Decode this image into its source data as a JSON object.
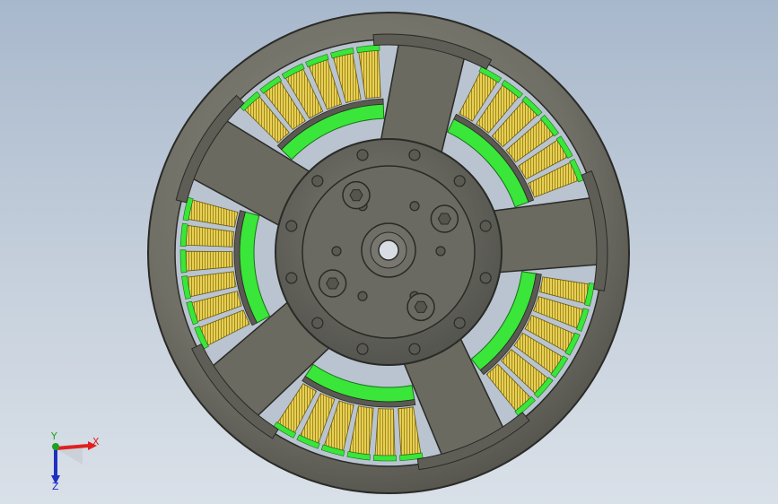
{
  "viewport": {
    "background_top": "#a8b8cc",
    "background_bottom": "#d9e0e8"
  },
  "model": {
    "name_icon": "motor-model-icon",
    "colors": {
      "housing": "#6f6f66",
      "housing_dark": "#4f4f48",
      "slot_bg": "#b8c3cf",
      "winding": "#e8cf52",
      "winding_dark": "#a08b22",
      "magnet_ring": "#39e639",
      "hub": "#5e5e57"
    },
    "coil_groups": 5,
    "spokes": 5
  },
  "triad": {
    "x_label": "X",
    "y_label": "Y",
    "z_label": "Z",
    "x_color": "#e02020",
    "y_color": "#20a020",
    "z_color": "#2030c0"
  }
}
